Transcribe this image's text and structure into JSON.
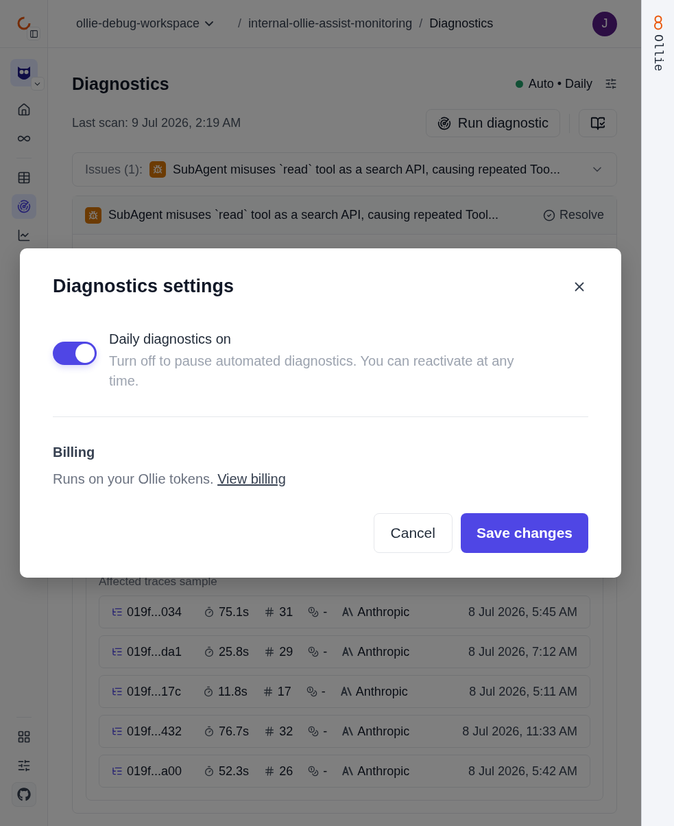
{
  "sidebar": {
    "items": [
      {
        "kind": "home",
        "selected": false
      },
      {
        "kind": "infinity",
        "selected": false
      },
      {
        "kind": "table",
        "selected": false
      },
      {
        "kind": "radar",
        "selected": true
      },
      {
        "kind": "chart",
        "selected": false
      }
    ],
    "bottom": [
      {
        "kind": "grid"
      },
      {
        "kind": "sliders"
      },
      {
        "kind": "github"
      }
    ]
  },
  "breadcrumb": {
    "workspace": "ollie-debug-workspace",
    "separator_1": "/",
    "project": "internal-ollie-assist-monitoring",
    "separator_2": "/",
    "page": "Diagnostics"
  },
  "user": {
    "initial": "J"
  },
  "header": {
    "title": "Diagnostics",
    "schedule": "Auto • Daily",
    "schedule_active": true,
    "last_scan": "Last scan: 9 Jul 2026, 2:19 AM",
    "run_button": "Run diagnostic"
  },
  "issues_bar": {
    "label": "Issues (1):",
    "title": "SubAgent misuses `read` tool as a search API, causing repeated Too..."
  },
  "issue_card": {
    "title": "SubAgent misuses `read` tool as a search API, causing repeated Tool...",
    "resolve": "Resolve",
    "section": "Affected traces sample",
    "traces": [
      {
        "id": "019f...034",
        "duration": "75.1s",
        "count": "31",
        "cost": "-",
        "provider": "Anthropic",
        "time": "8 Jul 2026, 5:45 AM"
      },
      {
        "id": "019f...da1",
        "duration": "25.8s",
        "count": "29",
        "cost": "-",
        "provider": "Anthropic",
        "time": "8 Jul 2026, 7:12 AM"
      },
      {
        "id": "019f...17c",
        "duration": "11.8s",
        "count": "17",
        "cost": "-",
        "provider": "Anthropic",
        "time": "8 Jul 2026, 5:11 AM"
      },
      {
        "id": "019f...432",
        "duration": "76.7s",
        "count": "32",
        "cost": "-",
        "provider": "Anthropic",
        "time": "8 Jul 2026, 11:33 AM"
      },
      {
        "id": "019f...a00",
        "duration": "52.3s",
        "count": "26",
        "cost": "-",
        "provider": "Anthropic",
        "time": "8 Jul 2026, 5:42 AM"
      }
    ]
  },
  "dialog": {
    "title": "Diagnostics settings",
    "toggle": {
      "label": "Daily diagnostics on",
      "description": "Turn off to pause automated diagnostics. You can reactivate at any time.",
      "on": true
    },
    "billing": {
      "heading": "Billing",
      "text": "Runs on your Ollie tokens.",
      "link": "View billing"
    },
    "cancel": "Cancel",
    "save": "Save changes"
  },
  "side_panel": {
    "label": "Ollie"
  }
}
